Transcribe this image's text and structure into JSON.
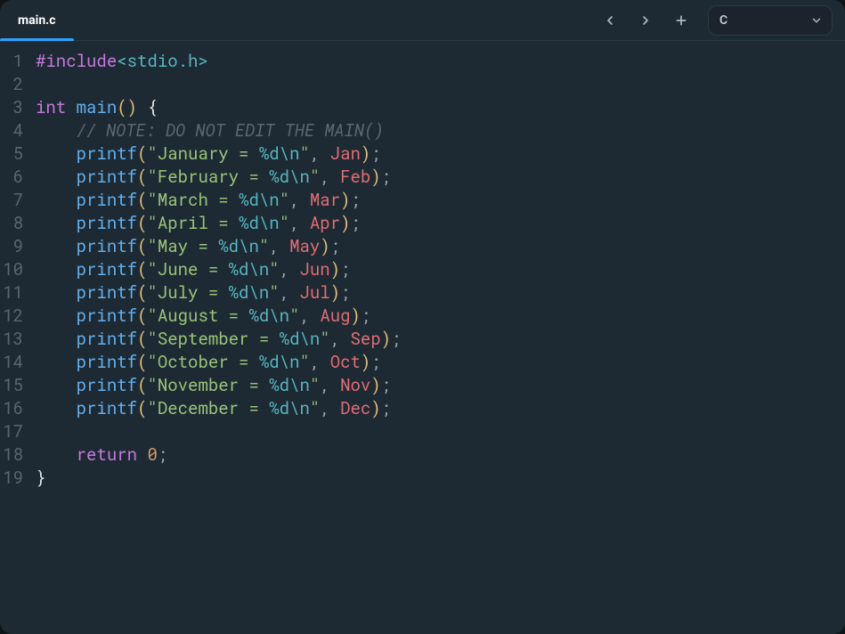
{
  "tab_label": "main.c",
  "lang": "C",
  "code": {
    "lines": [
      {
        "n": "1",
        "tokens": [
          {
            "c": "tok-pre",
            "t": "#include"
          },
          {
            "c": "tok-bracket",
            "t": "<stdio.h>"
          }
        ]
      },
      {
        "n": "2",
        "tokens": []
      },
      {
        "n": "3",
        "tokens": [
          {
            "c": "tok-kw",
            "t": "int"
          },
          {
            "c": "",
            "t": " "
          },
          {
            "c": "tok-func",
            "t": "main"
          },
          {
            "c": "tok-paren",
            "t": "()"
          },
          {
            "c": "",
            "t": " "
          },
          {
            "c": "tok-brace",
            "t": "{"
          }
        ]
      },
      {
        "n": "4",
        "tokens": [
          {
            "c": "",
            "t": "    "
          },
          {
            "c": "tok-cmt",
            "t": "// NOTE: DO NOT EDIT THE MAIN()"
          }
        ]
      },
      {
        "n": "5",
        "tokens": [
          {
            "c": "",
            "t": "    "
          },
          {
            "c": "tok-func",
            "t": "printf"
          },
          {
            "c": "tok-paren",
            "t": "("
          },
          {
            "c": "tok-str",
            "t": "\"January = "
          },
          {
            "c": "tok-esc",
            "t": "%d"
          },
          {
            "c": "tok-esc",
            "t": "\\n"
          },
          {
            "c": "tok-str",
            "t": "\""
          },
          {
            "c": "tok-punct",
            "t": ", "
          },
          {
            "c": "tok-id",
            "t": "Jan"
          },
          {
            "c": "tok-paren",
            "t": ")"
          },
          {
            "c": "tok-punct",
            "t": ";"
          }
        ]
      },
      {
        "n": "6",
        "tokens": [
          {
            "c": "",
            "t": "    "
          },
          {
            "c": "tok-func",
            "t": "printf"
          },
          {
            "c": "tok-paren",
            "t": "("
          },
          {
            "c": "tok-str",
            "t": "\"February = "
          },
          {
            "c": "tok-esc",
            "t": "%d"
          },
          {
            "c": "tok-esc",
            "t": "\\n"
          },
          {
            "c": "tok-str",
            "t": "\""
          },
          {
            "c": "tok-punct",
            "t": ", "
          },
          {
            "c": "tok-id",
            "t": "Feb"
          },
          {
            "c": "tok-paren",
            "t": ")"
          },
          {
            "c": "tok-punct",
            "t": ";"
          }
        ]
      },
      {
        "n": "7",
        "tokens": [
          {
            "c": "",
            "t": "    "
          },
          {
            "c": "tok-func",
            "t": "printf"
          },
          {
            "c": "tok-paren",
            "t": "("
          },
          {
            "c": "tok-str",
            "t": "\"March = "
          },
          {
            "c": "tok-esc",
            "t": "%d"
          },
          {
            "c": "tok-esc",
            "t": "\\n"
          },
          {
            "c": "tok-str",
            "t": "\""
          },
          {
            "c": "tok-punct",
            "t": ", "
          },
          {
            "c": "tok-id",
            "t": "Mar"
          },
          {
            "c": "tok-paren",
            "t": ")"
          },
          {
            "c": "tok-punct",
            "t": ";"
          }
        ]
      },
      {
        "n": "8",
        "tokens": [
          {
            "c": "",
            "t": "    "
          },
          {
            "c": "tok-func",
            "t": "printf"
          },
          {
            "c": "tok-paren",
            "t": "("
          },
          {
            "c": "tok-str",
            "t": "\"April = "
          },
          {
            "c": "tok-esc",
            "t": "%d"
          },
          {
            "c": "tok-esc",
            "t": "\\n"
          },
          {
            "c": "tok-str",
            "t": "\""
          },
          {
            "c": "tok-punct",
            "t": ", "
          },
          {
            "c": "tok-id",
            "t": "Apr"
          },
          {
            "c": "tok-paren",
            "t": ")"
          },
          {
            "c": "tok-punct",
            "t": ";"
          }
        ]
      },
      {
        "n": "9",
        "tokens": [
          {
            "c": "",
            "t": "    "
          },
          {
            "c": "tok-func",
            "t": "printf"
          },
          {
            "c": "tok-paren",
            "t": "("
          },
          {
            "c": "tok-str",
            "t": "\"May = "
          },
          {
            "c": "tok-esc",
            "t": "%d"
          },
          {
            "c": "tok-esc",
            "t": "\\n"
          },
          {
            "c": "tok-str",
            "t": "\""
          },
          {
            "c": "tok-punct",
            "t": ", "
          },
          {
            "c": "tok-id",
            "t": "May"
          },
          {
            "c": "tok-paren",
            "t": ")"
          },
          {
            "c": "tok-punct",
            "t": ";"
          }
        ]
      },
      {
        "n": "10",
        "tokens": [
          {
            "c": "",
            "t": "    "
          },
          {
            "c": "tok-func",
            "t": "printf"
          },
          {
            "c": "tok-paren",
            "t": "("
          },
          {
            "c": "tok-str",
            "t": "\"June = "
          },
          {
            "c": "tok-esc",
            "t": "%d"
          },
          {
            "c": "tok-esc",
            "t": "\\n"
          },
          {
            "c": "tok-str",
            "t": "\""
          },
          {
            "c": "tok-punct",
            "t": ", "
          },
          {
            "c": "tok-id",
            "t": "Jun"
          },
          {
            "c": "tok-paren",
            "t": ")"
          },
          {
            "c": "tok-punct",
            "t": ";"
          }
        ]
      },
      {
        "n": "11",
        "tokens": [
          {
            "c": "",
            "t": "    "
          },
          {
            "c": "tok-func",
            "t": "printf"
          },
          {
            "c": "tok-paren",
            "t": "("
          },
          {
            "c": "tok-str",
            "t": "\"July = "
          },
          {
            "c": "tok-esc",
            "t": "%d"
          },
          {
            "c": "tok-esc",
            "t": "\\n"
          },
          {
            "c": "tok-str",
            "t": "\""
          },
          {
            "c": "tok-punct",
            "t": ", "
          },
          {
            "c": "tok-id",
            "t": "Jul"
          },
          {
            "c": "tok-paren",
            "t": ")"
          },
          {
            "c": "tok-punct",
            "t": ";"
          }
        ]
      },
      {
        "n": "12",
        "tokens": [
          {
            "c": "",
            "t": "    "
          },
          {
            "c": "tok-func",
            "t": "printf"
          },
          {
            "c": "tok-paren",
            "t": "("
          },
          {
            "c": "tok-str",
            "t": "\"August = "
          },
          {
            "c": "tok-esc",
            "t": "%d"
          },
          {
            "c": "tok-esc",
            "t": "\\n"
          },
          {
            "c": "tok-str",
            "t": "\""
          },
          {
            "c": "tok-punct",
            "t": ", "
          },
          {
            "c": "tok-id",
            "t": "Aug"
          },
          {
            "c": "tok-paren",
            "t": ")"
          },
          {
            "c": "tok-punct",
            "t": ";"
          }
        ]
      },
      {
        "n": "13",
        "tokens": [
          {
            "c": "",
            "t": "    "
          },
          {
            "c": "tok-func",
            "t": "printf"
          },
          {
            "c": "tok-paren",
            "t": "("
          },
          {
            "c": "tok-str",
            "t": "\"September = "
          },
          {
            "c": "tok-esc",
            "t": "%d"
          },
          {
            "c": "tok-esc",
            "t": "\\n"
          },
          {
            "c": "tok-str",
            "t": "\""
          },
          {
            "c": "tok-punct",
            "t": ", "
          },
          {
            "c": "tok-id",
            "t": "Sep"
          },
          {
            "c": "tok-paren",
            "t": ")"
          },
          {
            "c": "tok-punct",
            "t": ";"
          }
        ]
      },
      {
        "n": "14",
        "tokens": [
          {
            "c": "",
            "t": "    "
          },
          {
            "c": "tok-func",
            "t": "printf"
          },
          {
            "c": "tok-paren",
            "t": "("
          },
          {
            "c": "tok-str",
            "t": "\"October = "
          },
          {
            "c": "tok-esc",
            "t": "%d"
          },
          {
            "c": "tok-esc",
            "t": "\\n"
          },
          {
            "c": "tok-str",
            "t": "\""
          },
          {
            "c": "tok-punct",
            "t": ", "
          },
          {
            "c": "tok-id",
            "t": "Oct"
          },
          {
            "c": "tok-paren",
            "t": ")"
          },
          {
            "c": "tok-punct",
            "t": ";"
          }
        ]
      },
      {
        "n": "15",
        "tokens": [
          {
            "c": "",
            "t": "    "
          },
          {
            "c": "tok-func",
            "t": "printf"
          },
          {
            "c": "tok-paren",
            "t": "("
          },
          {
            "c": "tok-str",
            "t": "\"November = "
          },
          {
            "c": "tok-esc",
            "t": "%d"
          },
          {
            "c": "tok-esc",
            "t": "\\n"
          },
          {
            "c": "tok-str",
            "t": "\""
          },
          {
            "c": "tok-punct",
            "t": ", "
          },
          {
            "c": "tok-id",
            "t": "Nov"
          },
          {
            "c": "tok-paren",
            "t": ")"
          },
          {
            "c": "tok-punct",
            "t": ";"
          }
        ]
      },
      {
        "n": "16",
        "tokens": [
          {
            "c": "",
            "t": "    "
          },
          {
            "c": "tok-func",
            "t": "printf"
          },
          {
            "c": "tok-paren",
            "t": "("
          },
          {
            "c": "tok-str",
            "t": "\"December = "
          },
          {
            "c": "tok-esc",
            "t": "%d"
          },
          {
            "c": "tok-esc",
            "t": "\\n"
          },
          {
            "c": "tok-str",
            "t": "\""
          },
          {
            "c": "tok-punct",
            "t": ", "
          },
          {
            "c": "tok-id",
            "t": "Dec"
          },
          {
            "c": "tok-paren",
            "t": ")"
          },
          {
            "c": "tok-punct",
            "t": ";"
          }
        ]
      },
      {
        "n": "17",
        "tokens": []
      },
      {
        "n": "18",
        "tokens": [
          {
            "c": "",
            "t": "    "
          },
          {
            "c": "tok-kw",
            "t": "return"
          },
          {
            "c": "",
            "t": " "
          },
          {
            "c": "tok-num",
            "t": "0"
          },
          {
            "c": "tok-punct",
            "t": ";"
          }
        ]
      },
      {
        "n": "19",
        "tokens": [
          {
            "c": "tok-brace",
            "t": "}"
          }
        ]
      }
    ]
  }
}
